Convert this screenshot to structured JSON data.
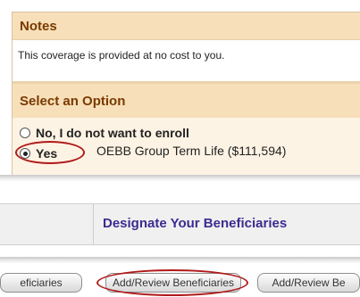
{
  "notes": {
    "title": "Notes",
    "text": "This coverage is provided at no cost to you."
  },
  "options": {
    "title": "Select an Option",
    "no_label": "No, I do not want to enroll",
    "yes_label": "Yes",
    "plan_text": "OEBB Group Term Life ($111,594)",
    "selected": "yes"
  },
  "beneficiaries": {
    "title": "Designate Your Beneficiaries",
    "buttons": [
      "eficiaries",
      "Add/Review Beneficiaries",
      "Add/Review Be"
    ]
  },
  "colors": {
    "section_header_bg": "#f7dfb9",
    "header_text": "#7a3a00",
    "link_title": "#3b2c8f",
    "highlight_ring": "#b01a1a"
  }
}
